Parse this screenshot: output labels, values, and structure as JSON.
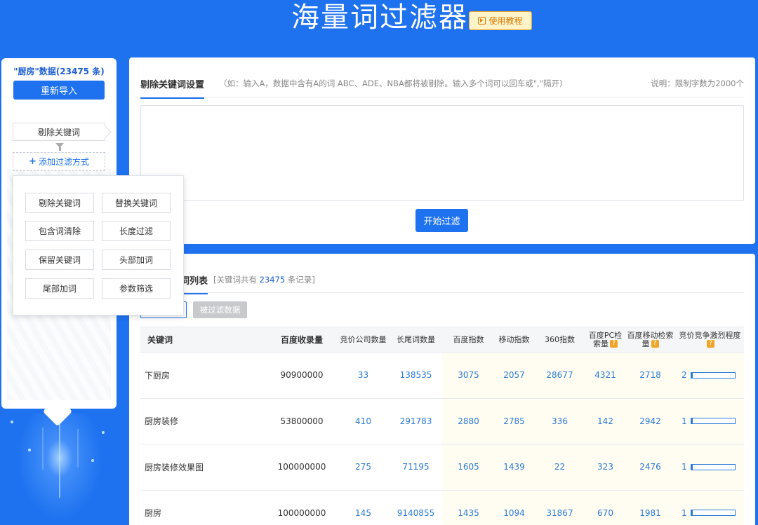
{
  "header": {
    "title": "海量词过滤器",
    "tutorial_label": "使用教程"
  },
  "sidebar": {
    "data_title": "\"厨房\"数据(23475 条)",
    "reimport_label": "重新导入",
    "filter_step_label": "剔除关键词",
    "add_filter_label": "添加过滤方式"
  },
  "popup": {
    "items": [
      "剔除关键词",
      "替换关键词",
      "包含词清除",
      "长度过滤",
      "保留关键词",
      "头部加词",
      "尾部加词",
      "参数筛选"
    ]
  },
  "settings": {
    "tab_label": "剔除关键词设置",
    "hint": "（如：输入A，数据中含有A的词 ABC、ADE、NBA都将被剔除。输入多个词可以回车或\",\"隔开)",
    "note": "说明：限制字数为2000个",
    "start_label": "开始过滤"
  },
  "list": {
    "tab_label": "词列表",
    "count_prefix": "[关键词共有",
    "count_value": "23475",
    "count_suffix": "条记录]",
    "filtered_label": "被过滤数据"
  },
  "table": {
    "headers": {
      "keyword": "关键词",
      "baidu_index_count": "百度收录量",
      "bid_companies": "竞价公司数量",
      "long_tail": "长尾词数量",
      "baidu_index": "百度指数",
      "mobile_index": "移动指数",
      "index_360": "360指数",
      "baidu_pc": "百度PC检索量",
      "baidu_mobile": "百度移动检索量",
      "competition": "竞价竞争激烈程度"
    },
    "rows": [
      {
        "keyword": "下厨房",
        "indexed": "90900000",
        "companies": "33",
        "long_tail": "138535",
        "baidu": "3075",
        "mobile": "2057",
        "i360": "28677",
        "pc": "4321",
        "mob_search": "2718",
        "comp": "2",
        "comp_fraction": 0.04
      },
      {
        "keyword": "厨房装修",
        "indexed": "53800000",
        "companies": "410",
        "long_tail": "291783",
        "baidu": "2880",
        "mobile": "2785",
        "i360": "336",
        "pc": "142",
        "mob_search": "2942",
        "comp": "1",
        "comp_fraction": 0.03
      },
      {
        "keyword": "厨房装修效果图",
        "indexed": "100000000",
        "companies": "275",
        "long_tail": "71195",
        "baidu": "1605",
        "mobile": "1439",
        "i360": "22",
        "pc": "323",
        "mob_search": "2476",
        "comp": "1",
        "comp_fraction": 0.03
      },
      {
        "keyword": "厨房",
        "indexed": "100000000",
        "companies": "145",
        "long_tail": "9140855",
        "baidu": "1435",
        "mobile": "1094",
        "i360": "31867",
        "pc": "670",
        "mob_search": "1981",
        "comp": "1",
        "comp_fraction": 0.03
      }
    ]
  },
  "colors": {
    "brand": "#1e72f0",
    "accent": "#f0a428"
  }
}
